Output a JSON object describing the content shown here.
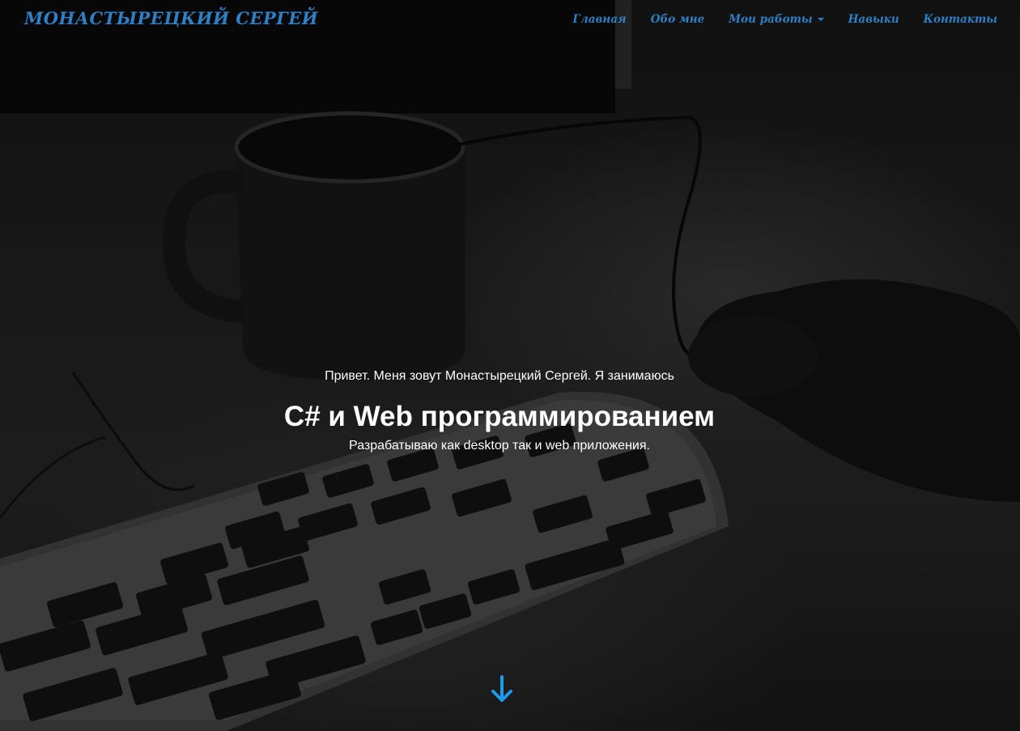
{
  "navbar": {
    "brand": "Монастырецкий Сергей",
    "items": [
      {
        "label": "Главная",
        "has_dropdown": false
      },
      {
        "label": "Обо мне",
        "has_dropdown": false
      },
      {
        "label": "Мои работы",
        "has_dropdown": true
      },
      {
        "label": "Навыки",
        "has_dropdown": false
      },
      {
        "label": "Контакты",
        "has_dropdown": false
      }
    ]
  },
  "hero": {
    "intro": "Привет. Меня зовут Монастырецкий Сергей. Я занимаюсь",
    "headline": "C# и Web программированием",
    "subtitle": "Разрабатываю как desktop так и web приложения.",
    "scroll_icon": "arrow-down-icon"
  },
  "colors": {
    "accent": "#2f7fc4",
    "scroll_arrow": "#1e9be8",
    "hero_text": "#ffffff",
    "overlay": "#1a1a1a"
  }
}
